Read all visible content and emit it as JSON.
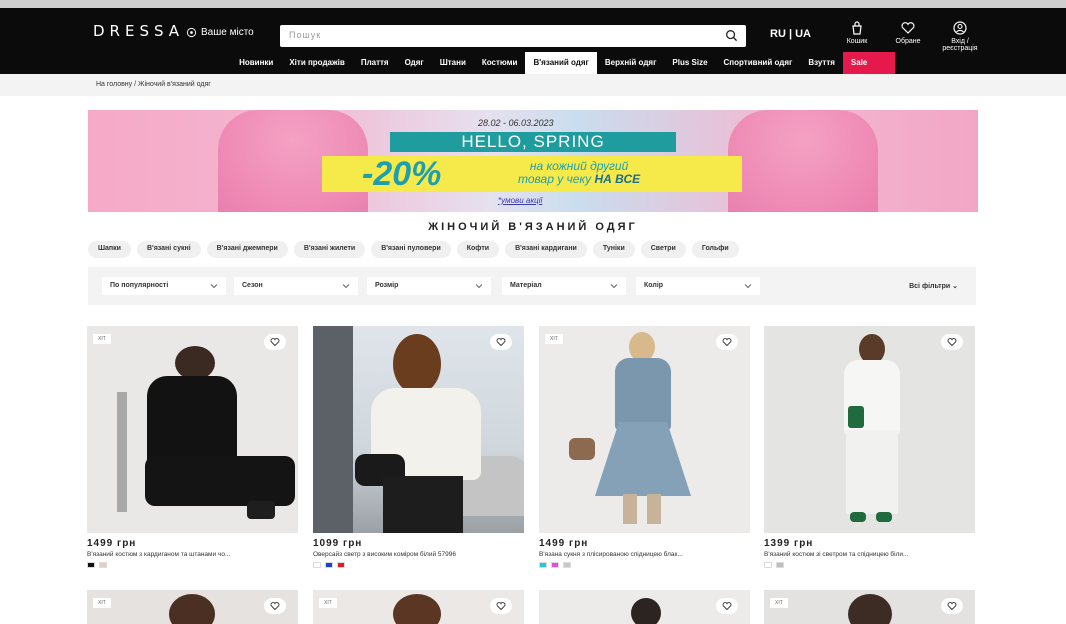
{
  "header": {
    "logo": "DRESSA",
    "city": "Ваше місто",
    "search_placeholder": "Пошук",
    "lang": "RU | UA",
    "icons": [
      {
        "name": "cart-icon",
        "label": "Кошик"
      },
      {
        "name": "heart-icon",
        "label": "Обране"
      },
      {
        "name": "user-icon",
        "label": "Вхід /\nреєстрація"
      }
    ]
  },
  "nav": {
    "items": [
      "Новинки",
      "Хіти продажів",
      "Плаття",
      "Одяг",
      "Штани",
      "Костюми",
      "В'язаний одяг",
      "Верхній одяг",
      "Plus Size",
      "Спортивний одяг",
      "Взуття",
      "Sale"
    ],
    "active": "В'язаний одяг"
  },
  "breadcrumb": "На головну  /  Жіночий в'язаний одяг",
  "banner": {
    "dates": "28.02 - 06.03.2023",
    "headline": "HELLO, SPRING",
    "percent": "-20%",
    "line1": "на кожний другий",
    "line2_a": "товар у чеку ",
    "line2_b": "НА ВСЕ",
    "terms": "*умови акції"
  },
  "page_title": "ЖІНОЧИЙ В'ЯЗАНИЙ ОДЯГ",
  "chips": [
    "Шапки",
    "В'язані сукні",
    "В'язані джемпери",
    "В'язані жилети",
    "В'язані пуловери",
    "Кофти",
    "В'язані кардигани",
    "Туніки",
    "Светри",
    "Гольфи"
  ],
  "filters": {
    "selects": [
      "По популярності",
      "Сезон",
      "Розмір",
      "Матеріал",
      "Колір"
    ],
    "all_filters": "Всі фільтри"
  },
  "products": [
    {
      "badge": "ХІТ",
      "price": "1499 грн",
      "name": "В'язаний костюм з кардиганом та штанами чо...",
      "swatches": [
        "#111111",
        "#e2cfc0"
      ]
    },
    {
      "badge": "",
      "price": "1099 грн",
      "name": "Оверсайз светр з високим коміром білий 57996",
      "swatches": [
        "#ffffff",
        "#1d3fd8",
        "#e01b24"
      ]
    },
    {
      "badge": "ХІТ",
      "price": "1499 грн",
      "name": "В'язана сукня з плісированою спідницею блак...",
      "swatches": [
        "#2bc3e3",
        "#e24fd9",
        "#c8c8c8"
      ]
    },
    {
      "badge": "",
      "price": "1399 грн",
      "name": "В'язаний костюм зі светром та спідницею біли...",
      "swatches": [
        "#ffffff",
        "#bdbdbd"
      ]
    }
  ],
  "products_row2_badges": [
    "ХІТ",
    "ХІТ",
    "",
    "ХІТ"
  ]
}
